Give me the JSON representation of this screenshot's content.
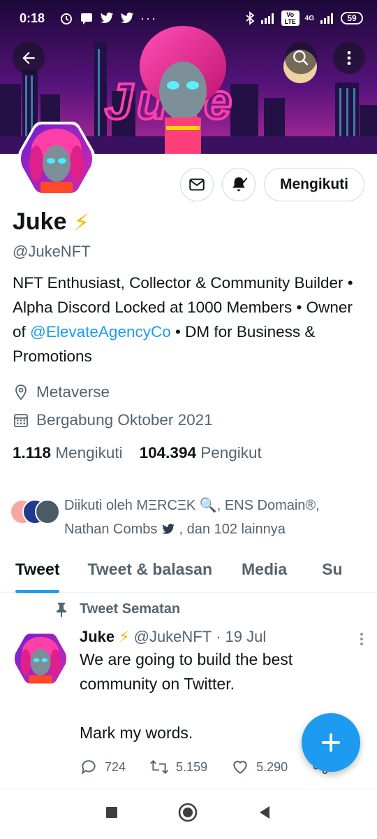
{
  "status_bar": {
    "time": "0:18",
    "lte_label": "Vo LTE",
    "network_label": "4G",
    "battery": "59"
  },
  "banner": {
    "logo_text": "Juke",
    "colors": {
      "sky_top": "#2a0a4a",
      "sky_bottom": "#7a1fa0",
      "neon": "#ff3fa8"
    }
  },
  "actions": {
    "follow_label": "Mengikuti"
  },
  "profile": {
    "name": "Juke",
    "emoji": "⚡",
    "handle": "@JukeNFT",
    "bio_part1": "NFT Enthusiast, Collector & Community Builder • Alpha Discord Locked at 1000 Members • Owner of ",
    "bio_mention": "@ElevateAgencyCo",
    "bio_part2": " • DM for Business & Promotions",
    "location": "Metaverse",
    "joined": "Bergabung Oktober 2021",
    "following_count": "1.118",
    "following_label": "Mengikuti",
    "followers_count": "104.394",
    "followers_label": "Pengikut"
  },
  "followed_by": {
    "line1": "Diikuti oleh MΞRCΞK 🔍, ENS Domain®,",
    "line2": "Nathan Combs",
    "line2_tail": ", dan 102 lainnya"
  },
  "tabs": [
    {
      "label": "Tweet"
    },
    {
      "label": "Tweet & balasan"
    },
    {
      "label": "Media"
    },
    {
      "label": "Su"
    }
  ],
  "pinned_label": "Tweet Sematan",
  "tweet": {
    "name": "Juke",
    "emoji": "⚡",
    "handle": "@JukeNFT",
    "sep": "·",
    "date": "19 Jul",
    "line1": "We are going to build the best community on Twitter.",
    "line2": "Mark my words.",
    "replies": "724",
    "retweets": "5.159",
    "likes": "5.290"
  },
  "colors": {
    "accent": "#1d9bf0",
    "text": "#0f1419",
    "muted": "#536471"
  },
  "icons": [
    "back-arrow-icon",
    "search-icon",
    "more-vertical-icon",
    "mail-icon",
    "bell-icon",
    "location-pin-icon",
    "calendar-icon",
    "pin-icon",
    "reply-icon",
    "retweet-icon",
    "like-icon",
    "share-icon",
    "compose-plus-icon",
    "nav-square-icon",
    "nav-home-icon",
    "nav-back-icon"
  ]
}
